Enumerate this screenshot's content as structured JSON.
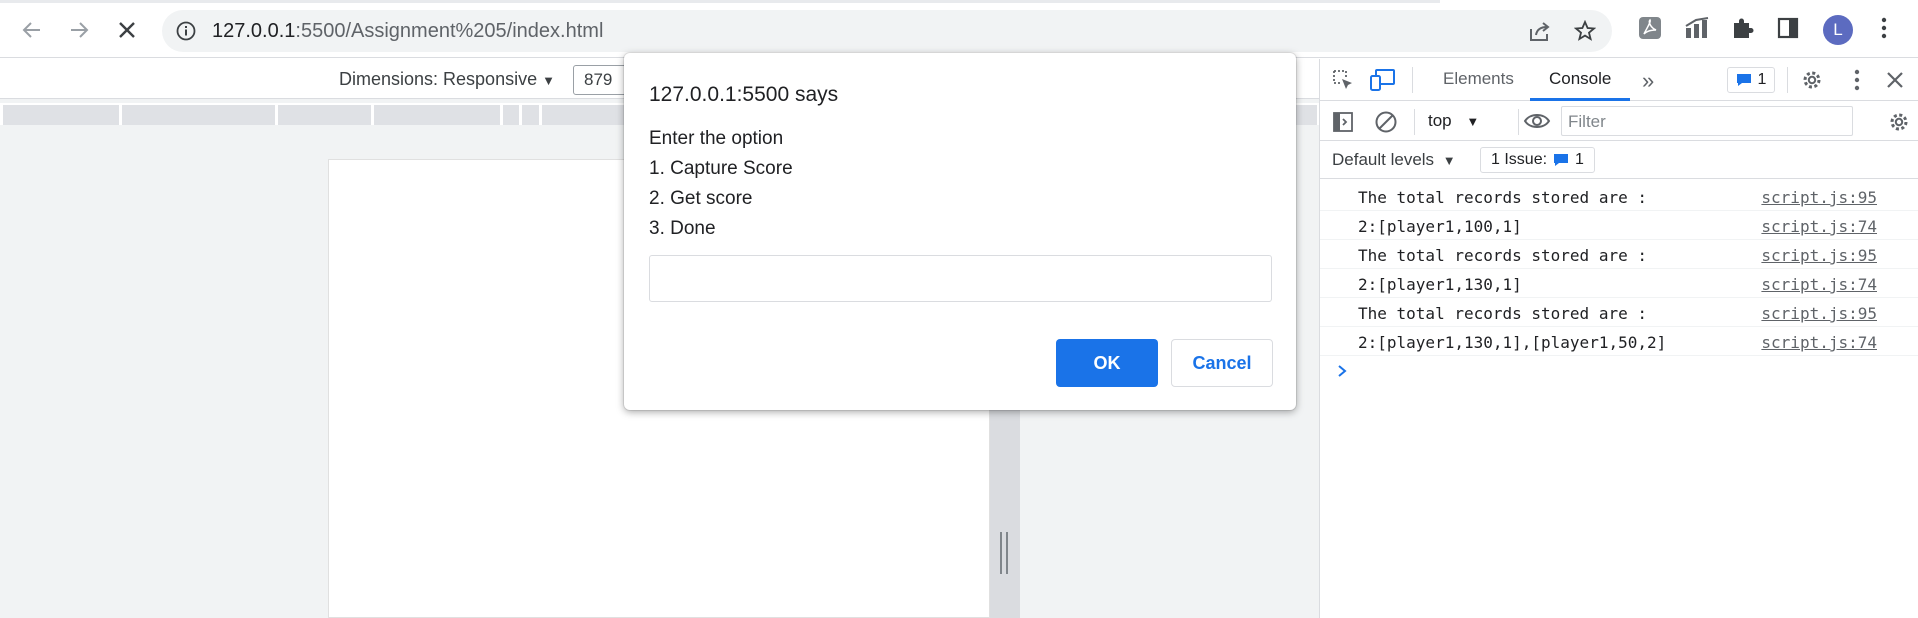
{
  "browser": {
    "url_host": "127.0.0.1",
    "url_rest": ":5500/Assignment%205/index.html",
    "avatar_letter": "L"
  },
  "device_toolbar": {
    "dimensions_label": "Dimensions: Responsive",
    "width_value": "879"
  },
  "devtools": {
    "tabs": [
      "Elements",
      "Console"
    ],
    "active_tab": "Console",
    "issue_badge_count": "1",
    "context": "top",
    "filter_placeholder": "Filter",
    "levels_label": "Default levels",
    "issues_label": "1 Issue:",
    "issues_count": "1",
    "console_lines": [
      {
        "message": "The total records stored are :",
        "source": "script.js:95"
      },
      {
        "message": "2:[player1,100,1]",
        "source": "script.js:74"
      },
      {
        "message": "The total records stored are :",
        "source": "script.js:95"
      },
      {
        "message": "2:[player1,130,1]",
        "source": "script.js:74"
      },
      {
        "message": "The total records stored are :",
        "source": "script.js:95"
      },
      {
        "message": "2:[player1,130,1],[player1,50,2]",
        "source": "script.js:74"
      }
    ]
  },
  "dialog": {
    "title": "127.0.0.1:5500 says",
    "lines": [
      "Enter the option",
      "1. Capture Score",
      "2. Get score",
      "3. Done"
    ],
    "input_value": "",
    "ok_label": "OK",
    "cancel_label": "Cancel"
  },
  "colors": {
    "accent": "#1a73e8",
    "avatar": "#5c6bc0"
  }
}
